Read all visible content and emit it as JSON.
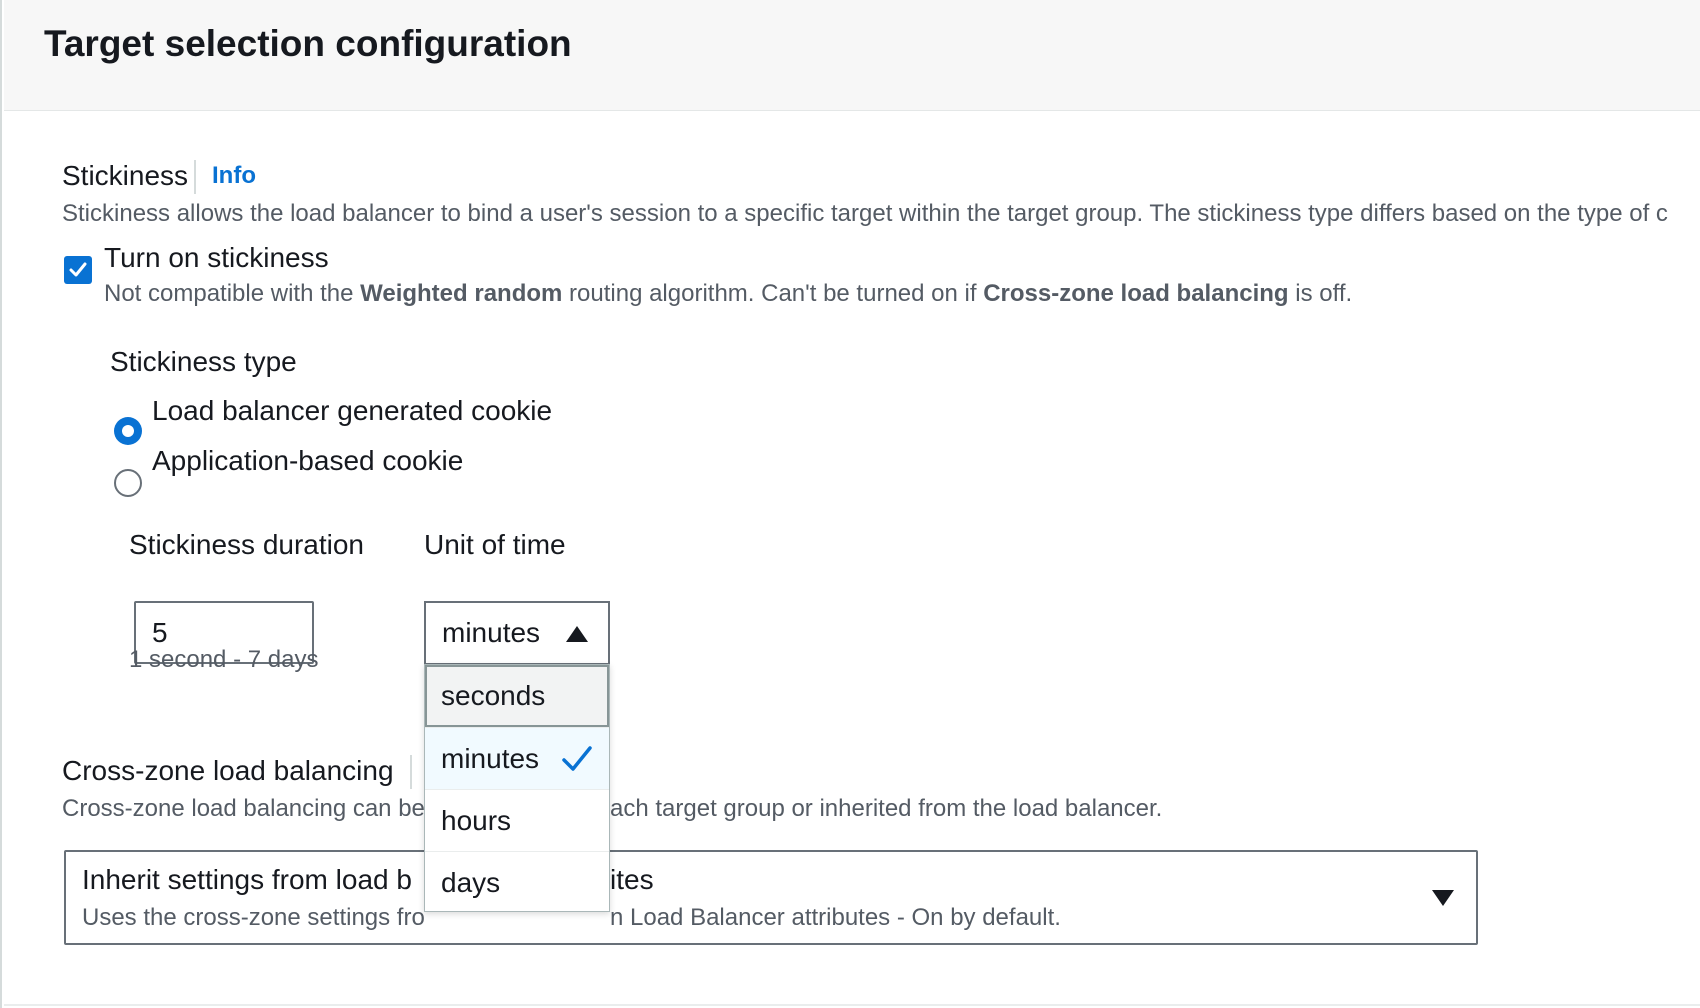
{
  "header": {
    "title": "Target selection configuration"
  },
  "stickiness": {
    "label": "Stickiness",
    "info": "Info",
    "description": "Stickiness allows the load balancer to bind a user's session to a specific target within the target group. The stickiness type differs based on the type of c",
    "checkbox_label": "Turn on stickiness",
    "checked": true,
    "note_part1": "Not compatible with the ",
    "note_bold1": "Weighted random",
    "note_part2": " routing algorithm. Can't be turned on if ",
    "note_bold2": "Cross-zone load balancing",
    "note_part3": " is off."
  },
  "stickiness_type": {
    "label": "Stickiness type",
    "options": [
      {
        "label": "Load balancer generated cookie",
        "selected": true
      },
      {
        "label": "Application-based cookie",
        "selected": false
      }
    ]
  },
  "duration": {
    "label": "Stickiness duration",
    "value": "5",
    "hint": "1 second - 7 days"
  },
  "unit": {
    "label": "Unit of time",
    "value": "minutes",
    "options": [
      "seconds",
      "minutes",
      "hours",
      "days"
    ],
    "selected_index": 1,
    "hover_index": 0
  },
  "cross_zone": {
    "label": "Cross-zone load balancing",
    "desc_left": "Cross-zone load balancing can be",
    "desc_right": "ach target group or inherited from the load balancer.",
    "select_title_left": "Inherit settings from load b",
    "select_title_right": "ites",
    "select_sub_left": "Uses the cross-zone settings fro",
    "select_sub_right": "n Load Balancer attributes - On by default."
  },
  "colors": {
    "accent": "#0972d3",
    "text": "#16191f",
    "secondary": "#545b64",
    "border": "#687078"
  },
  "icons": [
    "check-icon",
    "caret-up-icon",
    "caret-down-icon",
    "checkmark-icon"
  ]
}
